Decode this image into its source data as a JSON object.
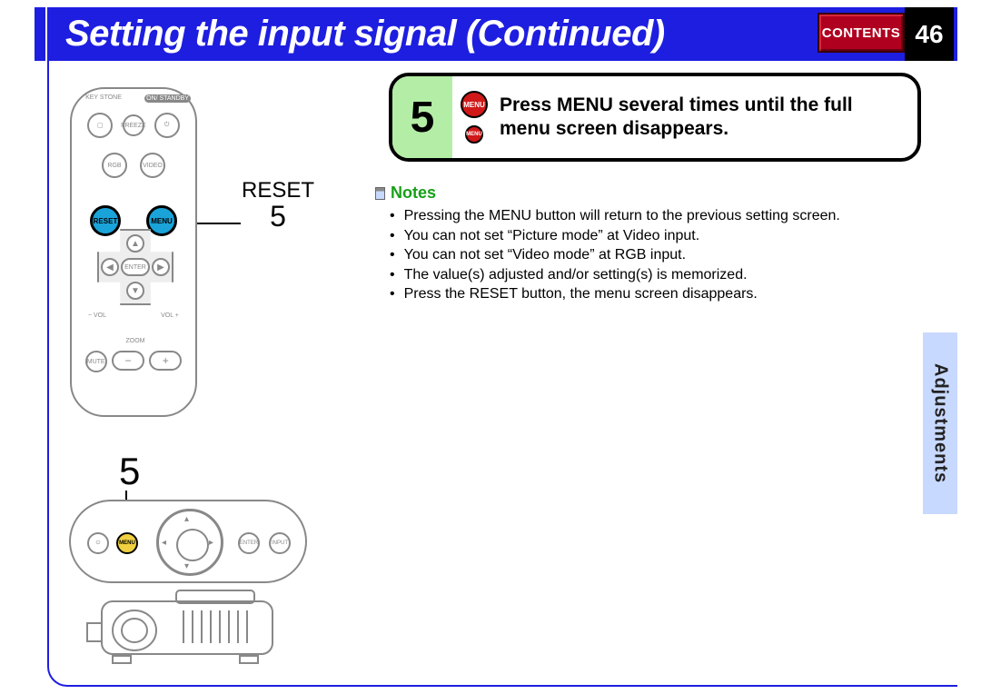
{
  "header": {
    "title": "Setting the input signal (Continued)",
    "contents_label": "CONTENTS",
    "page_number": "46"
  },
  "side_tab": "Adjustments",
  "step": {
    "number": "5",
    "icon_labels": {
      "menu": "MENU"
    },
    "text": "Press MENU several times until the full menu screen disappears."
  },
  "notes": {
    "heading": "Notes",
    "items": [
      "Pressing the MENU button will return to the previous setting screen.",
      "You can not set “Picture mode” at Video input.",
      "You can not set “Video mode” at RGB input.",
      "The value(s) adjusted and/or setting(s) is memorized.",
      "Press the RESET button, the menu screen disappears."
    ]
  },
  "remote_callout": {
    "label": "RESET",
    "number": "5"
  },
  "remote_labels": {
    "keystone": "KEY\nSTONE",
    "on_standby": "ON/\nSTANDBY",
    "freeze": "FREEZE",
    "rgb": "RGB",
    "video": "VIDEO",
    "reset": "RESET",
    "menu": "MENU",
    "enter": "ENTER",
    "vol_minus": "VOL",
    "vol_plus": "VOL",
    "zoom": "ZOOM",
    "mute": "MUTE"
  },
  "panel_number": "5",
  "panel_labels": {
    "power": "⏻",
    "menu": "MENU",
    "enter": "ENTER",
    "input": "INPUT"
  }
}
